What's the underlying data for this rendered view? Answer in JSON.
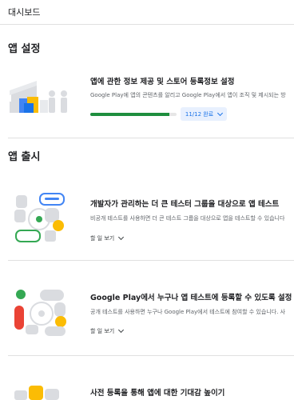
{
  "breadcrumb": "대시보드",
  "sections": {
    "setup_title": "앱 설정",
    "release_title": "앱 출시"
  },
  "setup_card": {
    "title": "앱에 관한 정보 제공 및 스토어 등록정보 설정",
    "desc": "Google Play에 앱의 콘텐츠를 알리고 Google Play에서 앱이 조직 및 제시되는 방",
    "progress_label": "11/12 완료",
    "progress_value": 0.9167
  },
  "release_cards": [
    {
      "title": "개발자가 관리하는 더 큰 테스터 그룹을 대상으로 앱 테스트",
      "desc": "비공개 테스트를 사용하면 더 큰 테스트 그룹을 대상으로 앱을 테스트할 수 있습니다",
      "link": "할 일 보기"
    },
    {
      "title": "Google Play에서 누구나 앱 테스트에 등록할 수 있도록 설정",
      "desc": "공개 테스트를 사용하면 누구나 Google Play에서 테스트에 참여할 수 있습니다. 사",
      "link": "할 일 보기"
    },
    {
      "title": "사전 등록을 통해 앱에 대한 기대감 높이기"
    }
  ],
  "colors": {
    "accent_blue": "#1a73e8",
    "progress_green": "#1e8e3e",
    "brand_yellow": "#fbbc04",
    "brand_red": "#ea4335"
  }
}
